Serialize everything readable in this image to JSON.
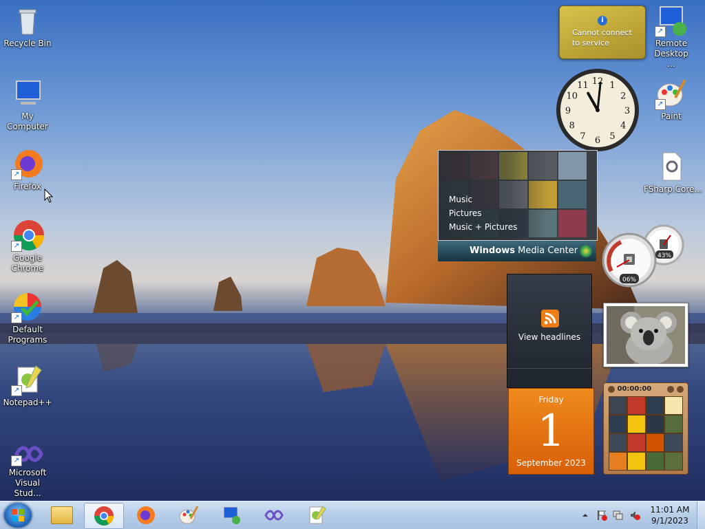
{
  "desktop_icons": [
    {
      "label": "Recycle Bin",
      "icon": "recycle-bin-icon"
    },
    {
      "label": "My Computer",
      "icon": "computer-icon"
    },
    {
      "label": "Firefox",
      "icon": "firefox-icon"
    },
    {
      "label": "Google Chrome",
      "icon": "chrome-icon"
    },
    {
      "label": "Default Programs",
      "icon": "default-programs-icon"
    },
    {
      "label": "Notepad++",
      "icon": "notepadpp-icon"
    },
    {
      "label": "Microsoft Visual Stud...",
      "icon": "visual-studio-icon"
    },
    {
      "label": "Remote Desktop ...",
      "icon": "remote-desktop-icon"
    },
    {
      "label": "Paint",
      "icon": "paint-icon"
    },
    {
      "label": "FSharp.Core...",
      "icon": "file-icon"
    }
  ],
  "gadgets": {
    "weather": {
      "message": "Cannot connect to service"
    },
    "clock": {
      "hour": 11,
      "minute": 1,
      "numerals": [
        "1",
        "2",
        "3",
        "4",
        "5",
        "6",
        "7",
        "8",
        "9",
        "10",
        "11",
        "12"
      ]
    },
    "media_center": {
      "items": [
        "Music",
        "Pictures",
        "Music + Pictures"
      ],
      "brand_bold": "Windows",
      "brand_rest": " Media Center"
    },
    "cpu_meter": {
      "cpu": "06%",
      "memory": "43%"
    },
    "feed": {
      "label": "View headlines"
    },
    "calendar": {
      "weekday": "Friday",
      "day": "1",
      "month_year": "September 2023"
    },
    "puzzle": {
      "timer": "00:00:00"
    }
  },
  "taskbar": {
    "start": "start-orb-icon",
    "pinned": [
      "explorer-icon",
      "chrome-icon",
      "firefox-icon",
      "paint-icon",
      "remote-desktop-icon",
      "visual-studio-icon",
      "notepadpp-icon"
    ],
    "time": "11:01 AM",
    "date": "9/1/2023"
  },
  "colors": {
    "taskbar": "#b6cde8",
    "calendar": "#e8740c",
    "weather": "#c9b13a"
  }
}
